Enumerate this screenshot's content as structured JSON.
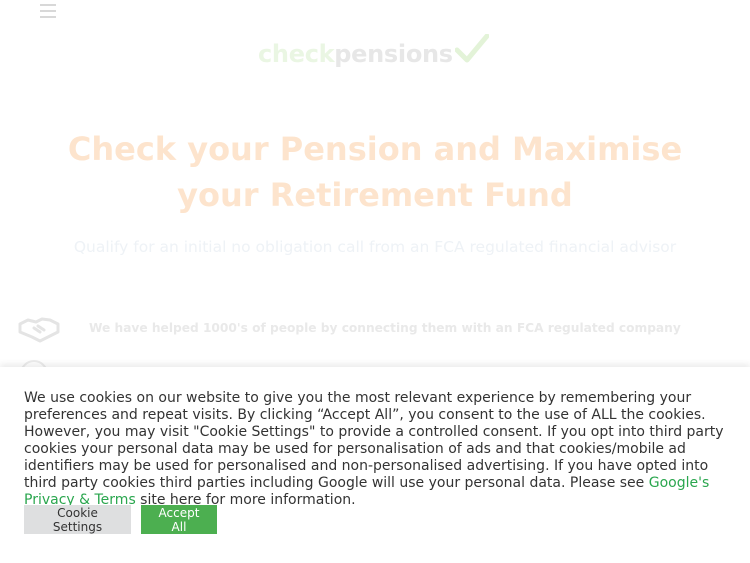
{
  "header": {
    "logo": {
      "part1": "check",
      "part2": "pensions"
    }
  },
  "hero": {
    "title": "Check your Pension and Maximise your Retirement Fund",
    "subtitle": "Qualify for an initial no obligation call from an FCA regulated financial advisor"
  },
  "features": [
    {
      "icon": "handshake-icon",
      "text": "We have helped 1000's of people by connecting them with an FCA regulated company"
    }
  ],
  "cookie": {
    "text_before": "We use cookies on our website to give you the most relevant experience by remembering your preferences and repeat visits. By clicking “Accept All”, you consent to the use of ALL the cookies. However, you may visit \"Cookie Settings\" to provide a controlled consent. If you opt into third party cookies your personal data may be used for personalisation of ads and that cookies/mobile ad identifiers may be used for personalised and non-personalised advertising. If you have opted into third party cookies third parties including Google will use your personal data. Please see ",
    "link_text": "Google's Privacy & Terms",
    "text_after": " site here for more information.",
    "settings_label": "Cookie Settings",
    "accept_label": "Accept All"
  },
  "colors": {
    "accent_green": "#4caf50",
    "link_green": "#2aa64e",
    "hero_title": "#fde4cd"
  }
}
